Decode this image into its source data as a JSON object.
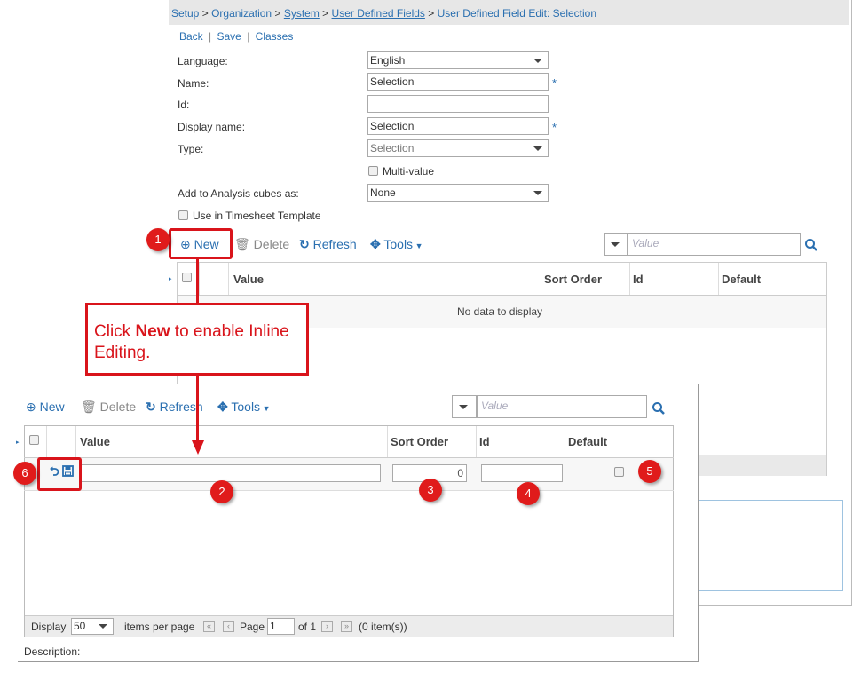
{
  "breadcrumb": {
    "items": [
      "Setup",
      "Organization",
      "System",
      "User Defined Fields",
      "User Defined Field Edit: Selection"
    ],
    "separator": ">"
  },
  "actions": {
    "back": "Back",
    "save": "Save",
    "classes": "Classes",
    "separator": "|"
  },
  "form": {
    "language_label": "Language:",
    "language_value": "English",
    "name_label": "Name:",
    "name_value": "Selection",
    "id_label": "Id:",
    "id_value": "",
    "display_name_label": "Display name:",
    "display_name_value": "Selection",
    "type_label": "Type:",
    "type_value": "Selection",
    "multi_value_label": "Multi-value",
    "analysis_label": "Add to Analysis cubes as:",
    "analysis_value": "None",
    "timesheet_label": "Use in Timesheet Template",
    "required_mark": "*"
  },
  "toolbar": {
    "new": "New",
    "delete": "Delete",
    "refresh": "Refresh",
    "tools": "Tools",
    "search_placeholder": "Value"
  },
  "grid": {
    "columns": [
      "Value",
      "Sort Order",
      "Id",
      "Default"
    ],
    "empty_text": "No data to display"
  },
  "edit_row": {
    "sort_order_value": "0"
  },
  "callout": {
    "prefix": "Click ",
    "bold": "New",
    "suffix": " to enable Inline Editing."
  },
  "badges": [
    "1",
    "2",
    "3",
    "4",
    "5",
    "6"
  ],
  "pager": {
    "display_label": "Display",
    "page_size": "50",
    "items_per_page": "items per page",
    "page_label": "Page",
    "page_value": "1",
    "of_label": "of 1",
    "items_count": "(0 item(s))"
  },
  "description_label": "Description:",
  "colors": {
    "accent": "#2a6fb0",
    "annotation": "#d9141b"
  },
  "icons": [
    "plus-circle-icon",
    "trash-icon",
    "refresh-icon",
    "tools-icon",
    "search-icon",
    "undo-icon",
    "save-icon"
  ]
}
